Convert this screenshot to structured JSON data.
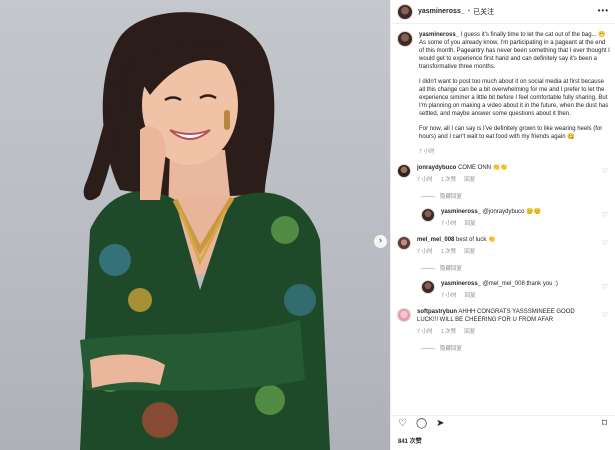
{
  "post": {
    "username": "yasmineross_",
    "separator": "•",
    "follow_label": "已关注",
    "caption": {
      "username": "yasmineross_",
      "paragraphs": [
        "I guess it's finally time to let the cat out of the bag... 😬 As some of you already know, I'm participating in a pageant at the end of this month. Pageantry has never been something that I ever thought I would get to experience first hand and can definitely say it's been a transformative three months.",
        "I didn't want to post too much about it on social media at first because all this change can be a bit overwhelming for me and I prefer to let the experience simmer a little bit before I feel comfortable fully sharing. But I'm planning on making a video about it in the future, when the dust has settled, and maybe answer some questions about it then.",
        "For now, all I can say is I've definitely grown to like wearing heels (for hours) and I can't wait to eat food with my friends again 😋"
      ],
      "time": "7 小时"
    },
    "comments": [
      {
        "username": "jonraydybuco",
        "text": "COME ONN 👏👏",
        "time": "7 小时",
        "likes": "1 次赞",
        "reply": "回复",
        "hide_replies": "隐藏回复"
      },
      {
        "username": "yasmineross_",
        "text": "@jonraydybuco 😊😊",
        "time": "7 小时",
        "likes": "",
        "reply": "回复"
      },
      {
        "username": "mel_mel_008",
        "text": "best of luck 👏",
        "time": "7 小时",
        "likes": "1 次赞",
        "reply": "回复",
        "hide_replies": "隐藏回复"
      },
      {
        "username": "yasmineross_",
        "text": "@mel_mel_008 thank you :)",
        "time": "7 小时",
        "likes": "",
        "reply": "回复"
      },
      {
        "username": "softpastrybun",
        "text": "AHHH CONGRATS YASSSMINEEE GOOD LUCK!!! WILL BE CHEERING FOR U FROM AFAR",
        "time": "7 小时",
        "likes": "1 次赞",
        "reply": "回复",
        "hide_replies": "隐藏回复"
      }
    ],
    "likes_count": "841 次赞"
  },
  "icons": {
    "more": "more-icon",
    "heart": "heart-icon",
    "comment": "comment-icon",
    "share": "share-icon",
    "save": "bookmark-icon",
    "next": "chevron-right-icon"
  },
  "colors": {
    "background": "#ffffff",
    "muted": "#8e8e8e",
    "text": "#262626",
    "photo_bg": "#bdc0c5",
    "dress": "#1f4a2a"
  }
}
